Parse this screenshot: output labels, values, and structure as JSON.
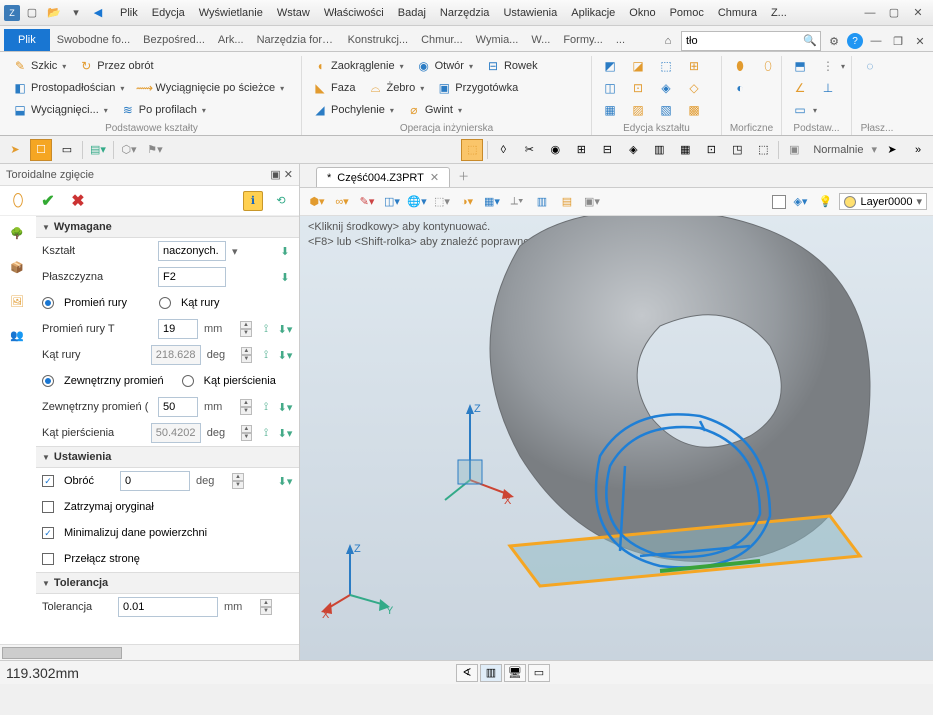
{
  "menus": [
    "Plik",
    "Edycja",
    "Wyświetlanie",
    "Wstaw",
    "Właściwości",
    "Badaj",
    "Narzędzia",
    "Ustawienia",
    "Aplikacje",
    "Okno",
    "Pomoc",
    "Chmura",
    "Z..."
  ],
  "ribbon": {
    "file_tab": "Plik",
    "tabs": [
      "Swobodne fo...",
      "Bezpośred...",
      "Ark...",
      "Narzędzia form...",
      "Konstrukcj...",
      "Chmur...",
      "Wymia...",
      "W...",
      "Formy...",
      "..."
    ],
    "search_placeholder": "tło",
    "groups": {
      "shapes": {
        "label": "Podstawowe kształty",
        "btns": [
          "Szkic",
          "Przez obrót",
          "Prostopadłościan",
          "Wyciągnięcie po ścieżce",
          "Wyciągnięci...",
          "Po profilach"
        ]
      },
      "eng": {
        "label": "Operacja inżynierska",
        "btns": [
          "Zaokrąglenie",
          "Otwór",
          "Rowek",
          "Faza",
          "Żebro",
          "Przygotówka",
          "Pochylenie",
          "Gwint"
        ]
      },
      "edit": {
        "label": "Edycja kształtu"
      },
      "morph": {
        "label": "Morficzne"
      },
      "base": {
        "label": "Podstaw..."
      },
      "surf": {
        "label": "Płasz..."
      }
    }
  },
  "display_mode": "Normalnie",
  "panel": {
    "title": "Toroidalne zgięcie",
    "sections": {
      "wymagane": "Wymagane",
      "ustawienia": "Ustawienia",
      "tolerancja": "Tolerancja"
    },
    "fields": {
      "ksztalt": {
        "label": "Kształt",
        "value": "naczonych."
      },
      "plaszczyzna": {
        "label": "Płaszczyzna",
        "value": "F2"
      },
      "promien_rury_opt": "Promień rury",
      "kat_rury_opt": "Kąt rury",
      "promien_rury_t": {
        "label": "Promień rury T",
        "value": "19",
        "unit": "mm"
      },
      "kat_rury": {
        "label": "Kąt rury",
        "value": "218.628",
        "unit": "deg"
      },
      "zew_promien_opt": "Zewnętrzny promień",
      "kat_pier_opt": "Kąt pierścienia",
      "zew_promien": {
        "label": "Zewnętrzny promień (",
        "value": "50",
        "unit": "mm"
      },
      "kat_pier": {
        "label": "Kąt pierścienia",
        "value": "50.4202",
        "unit": "deg"
      },
      "obroc": {
        "label": "Obróć",
        "value": "0",
        "unit": "deg"
      },
      "zatrzymaj": "Zatrzymaj oryginał",
      "minimalizuj": "Minimalizuj dane powierzchni",
      "przelacz": "Przełącz stronę",
      "tolerancja": {
        "label": "Tolerancja",
        "value": "0.01",
        "unit": "mm"
      }
    }
  },
  "doc": {
    "tab": "Część004.Z3PRT",
    "modified": "*"
  },
  "viewport": {
    "hint1": "<Kliknij środkowy> aby kontynuować.",
    "hint2": "<F8> lub <Shift-rolka> aby znaleźć poprawne ustawienia filtru.",
    "layer": "Layer0000",
    "axes": {
      "x": "X",
      "y": "Y",
      "z": "Z"
    }
  },
  "status": {
    "coord": "119.302mm"
  },
  "colors": {
    "accent": "#1976d2",
    "ok": "#33aa33",
    "cancel": "#cc3333",
    "warn": "#ffd050",
    "torus": "#9aa0a6",
    "wire": "#1f7fd6",
    "plate": "#f5a623"
  }
}
